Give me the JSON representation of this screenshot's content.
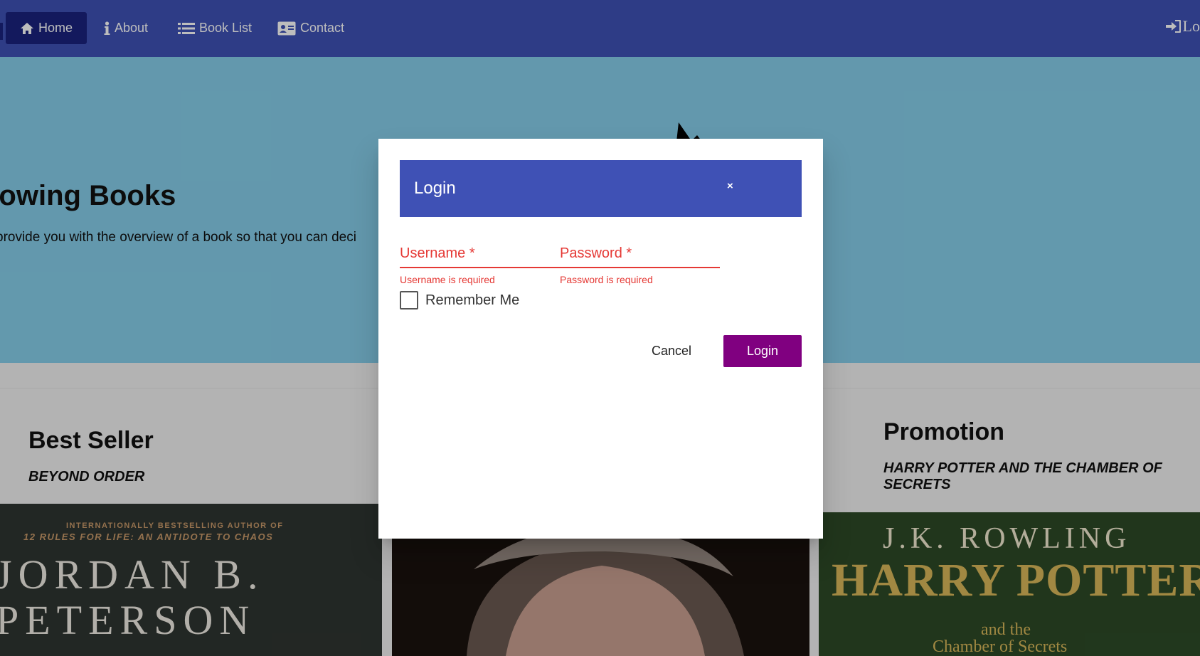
{
  "nav": {
    "items": [
      {
        "label": "Home",
        "icon": "home-icon"
      },
      {
        "label": "About",
        "icon": "info-icon"
      },
      {
        "label": "Book List",
        "icon": "list-icon"
      },
      {
        "label": "Contact",
        "icon": "contact-card-icon"
      }
    ],
    "login_label": "Lo"
  },
  "hero": {
    "title": "nowing Books",
    "subtitle": "provide you with the overview of a book so that you can deci"
  },
  "cards": [
    {
      "heading": "Best Seller",
      "book": "BEYOND ORDER"
    },
    {
      "heading": "Promotion",
      "book": "HARRY POTTER AND THE CHAMBER OF SECRETS"
    }
  ],
  "covers": {
    "peterson": {
      "line1": "INTERNATIONALLY BESTSELLING AUTHOR OF",
      "line2": "12 RULES FOR LIFE: AN ANTIDOTE TO CHAOS",
      "line3": "JORDAN B.",
      "line4": "PETERSON"
    },
    "harry_potter": {
      "author": "J.K. ROWLING",
      "title": "HARRY POTTER",
      "sub1": "and the",
      "sub2": "Chamber of Secrets"
    }
  },
  "dialog": {
    "title": "Login",
    "close": "×",
    "username": {
      "label": "Username *",
      "error": "Username is required"
    },
    "password": {
      "label": "Password *",
      "error": "Password is required"
    },
    "remember_label": "Remember Me",
    "cancel_label": "Cancel",
    "login_label": "Login"
  },
  "colors": {
    "navbar": "#3f51b5",
    "nav_active": "#1a237e",
    "hero": "#86ceea",
    "error": "#e53935",
    "login_button": "#800080"
  }
}
